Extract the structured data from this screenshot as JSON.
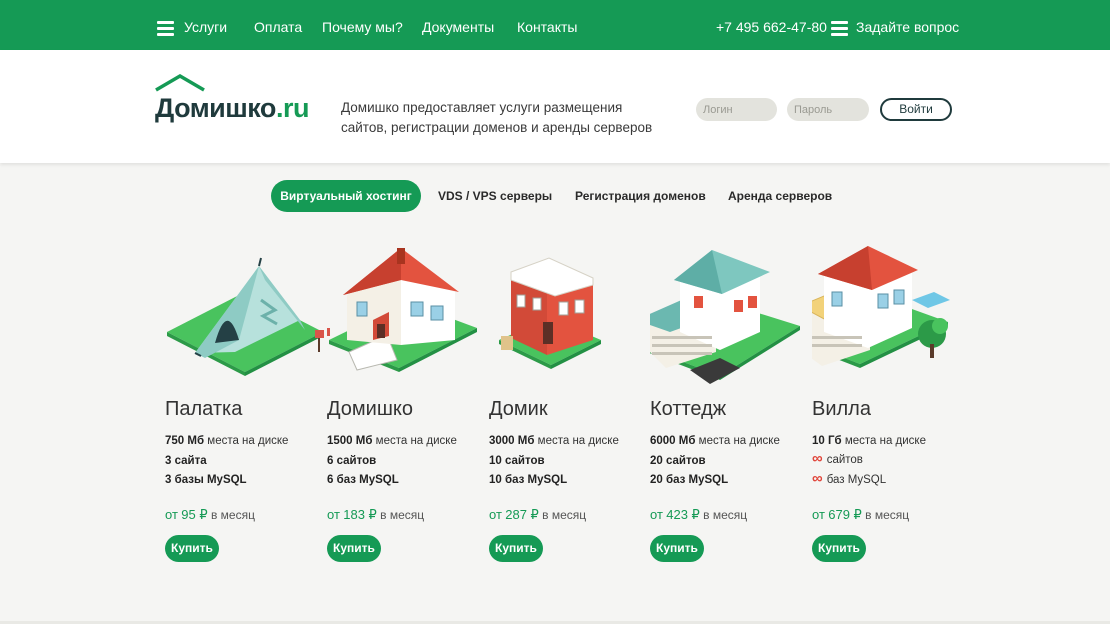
{
  "topbar": {
    "nav": [
      "Услуги",
      "Оплата",
      "Почему мы?",
      "Документы",
      "Контакты"
    ],
    "phone": "+7 495 662-47-80",
    "ask": "Задайте вопрос"
  },
  "header": {
    "logo_main": "Домишко",
    "logo_tld": ".ru",
    "tagline_line1": "Домишко предоставляет услуги размещения",
    "tagline_line2": "сайтов, регистрации доменов и аренды серверов",
    "login_placeholder": "Логин",
    "password_placeholder": "Пароль",
    "login_button": "Войти"
  },
  "tabs": [
    "Виртуальный хостинг",
    "VDS / VPS серверы",
    "Регистрация доменов",
    "Аренда серверов"
  ],
  "price_prefix": "от",
  "price_suffix": "в месяц",
  "buy_label": "Купить",
  "plans": [
    {
      "name": "Палатка",
      "disk_value": "750 Мб",
      "disk_label": "места на диске",
      "sites": "3 сайта",
      "dbs": "3 базы MySQL",
      "price": "95 ₽"
    },
    {
      "name": "Домишко",
      "disk_value": "1500 Мб",
      "disk_label": "места на диске",
      "sites": "6 сайтов",
      "dbs": "6 баз MySQL",
      "price": "183 ₽"
    },
    {
      "name": "Домик",
      "disk_value": "3000 Мб",
      "disk_label": "места на диске",
      "sites": "10 сайтов",
      "dbs": "10 баз MySQL",
      "price": "287 ₽"
    },
    {
      "name": "Коттедж",
      "disk_value": "6000 Мб",
      "disk_label": "места на диске",
      "sites": "20 сайтов",
      "dbs": "20 баз MySQL",
      "price": "423 ₽"
    },
    {
      "name": "Вилла",
      "disk_value": "10 Гб",
      "disk_label": "места на диске",
      "sites_inf": "∞",
      "sites_label": "сайтов",
      "dbs_inf": "∞",
      "dbs_label": "баз MySQL",
      "price": "679 ₽"
    }
  ],
  "colors": {
    "brand_green": "#159a55",
    "dark": "#1f3a3c",
    "infinity_red": "#e0453a"
  }
}
